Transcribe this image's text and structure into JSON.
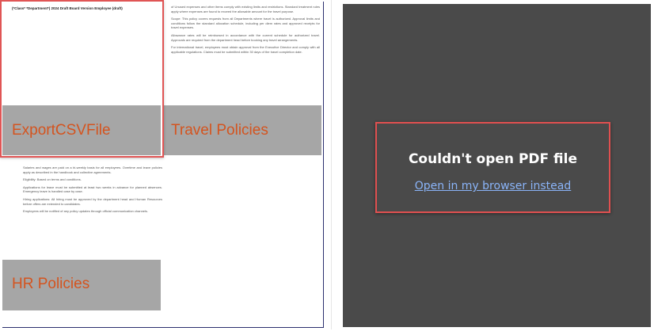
{
  "document": {
    "header": "(*Class* *Department*) 2024 Draft Board Version Employee (draft)",
    "right_column": [
      "of Unused expenses and other items comply with existing limits and restrictions. Standard treatment rules apply where expenses are found to exceed the allowable amount for the travel purpose.",
      "Scope: This policy covers requests from all Departments where travel is authorized. Approval limits and conditions follow the standard allocation schedule, including per diem rates and approved receipts for travel expenses.",
      "Allowance rates will be reimbursed in accordance with the current schedule for authorized travel. Approvals are required from the department head before booking any travel arrangements.",
      "For international travel, employees must obtain approval from the Executive Director and comply with all applicable regulations. Claims must be submitted within 30 days of the travel completion date."
    ],
    "left_column": [
      "Salaries and wages are paid on a bi-weekly basis for all employees. Overtime and leave policies apply as described in the handbook and collective agreements.",
      "Eligibility: Based on terms and conditions.",
      "Applications for leave must be submitted at least two weeks in advance for planned absences. Emergency leave is handled case by case.",
      "Hiring applications: All hiring must be approved by the department head and Human Resources before offers are extended to candidates.",
      "Employees will be notified of any policy updates through official communication channels."
    ]
  },
  "overlays": {
    "export": "ExportCSVFile",
    "travel": "Travel Policies",
    "hr": "HR Policies"
  },
  "pdf_viewer": {
    "error_title": "Couldn't open PDF file",
    "open_link": "Open in my browser instead"
  },
  "colors": {
    "viewer_bg": "#4a4a4a",
    "highlight_red": "#e05555",
    "overlay_grey": "#a6a6a6",
    "label_orange": "#d4541f",
    "link_blue": "#8ab4f8"
  }
}
